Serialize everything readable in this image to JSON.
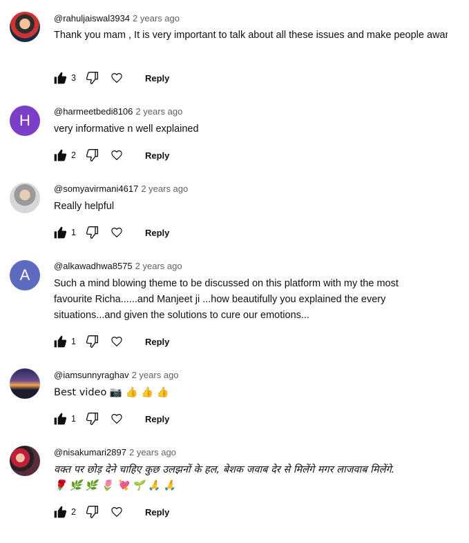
{
  "comments": [
    {
      "author": "@rahuljaiswal3934",
      "time": "2 years ago",
      "text": "Thank you mam , It is very important to talk about all these issues and make people\naware.",
      "likes": "3",
      "reply": "Reply",
      "avatar_icon": "user-photo"
    },
    {
      "author": "@harmeetbedi8106",
      "time": "2 years ago",
      "text": "very informative n well explained",
      "likes": "2",
      "reply": "Reply",
      "avatar_letter": "H",
      "avatar_color": "#7b3fc7"
    },
    {
      "author": "@somyavirmani4617",
      "time": "2 years ago",
      "text": "Really helpful",
      "likes": "1",
      "reply": "Reply",
      "avatar_icon": "user-photo"
    },
    {
      "author": "@alkawadhwa8575",
      "time": "2 years ago",
      "text": "Such a mind blowing theme to be discussed on this platform with my the most\nfavourite Richa......and Manjeet ji ...how beautifully you explained the every\nsituations...and given the solutions to cure our emotions...",
      "likes": "1",
      "reply": "Reply",
      "avatar_letter": "A",
      "avatar_color": "#5c6bc0"
    },
    {
      "author": "@iamsunnyraghav",
      "time": "2 years ago",
      "text": "Best video 📷 👍 👍 👍",
      "likes": "1",
      "reply": "Reply",
      "avatar_icon": "user-photo"
    },
    {
      "author": "@nisakumari2897",
      "time": "2 years ago",
      "text": "वक्त पर छोड़ देने चाहिए कुछ उलझनों के हल, बेशक जवाब देर से मिलेंगे मगर लाजवाब मिलेंगे.\n🌹 🌿 🌿 🌷 💘 🌱 🙏 🙏",
      "likes": "2",
      "reply": "Reply",
      "avatar_icon": "user-photo"
    }
  ],
  "icons": {
    "like": "thumbs-up-icon",
    "dislike": "thumbs-down-icon",
    "heart": "heart-icon"
  }
}
